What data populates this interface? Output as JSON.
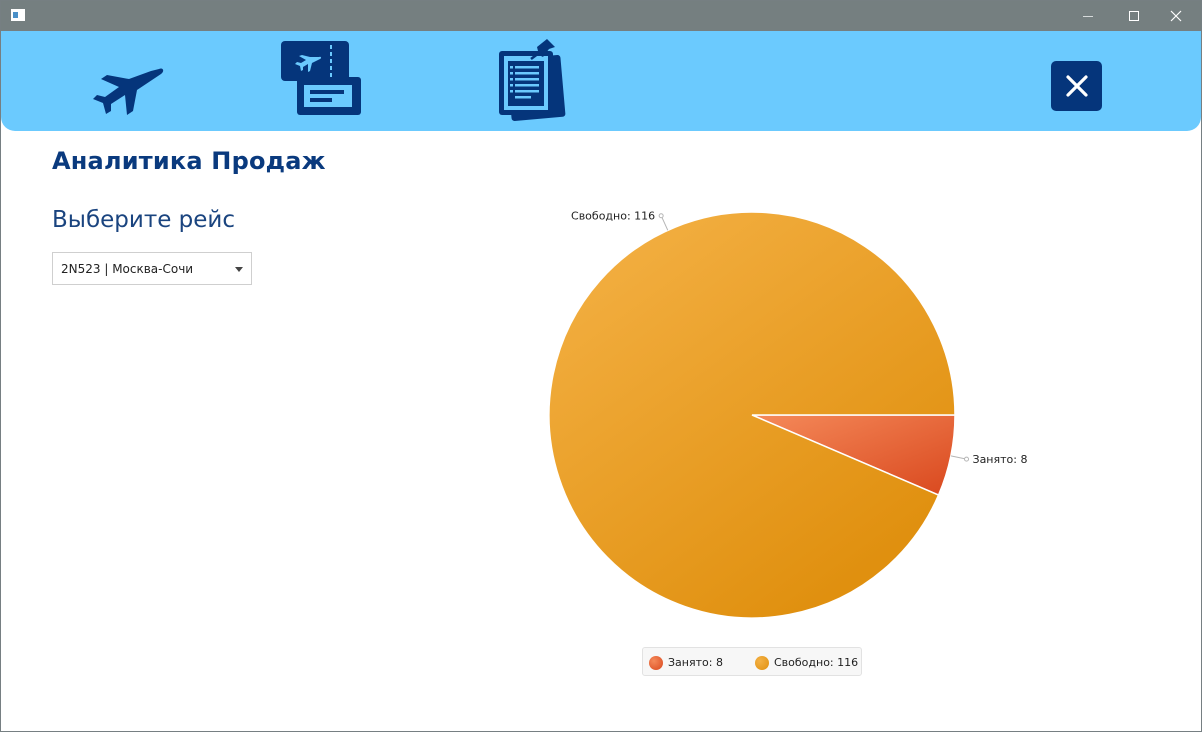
{
  "app": {
    "dropdown_arrow": "chevron-down"
  },
  "toolbar": {
    "icons": [
      "airplane-icon",
      "ticket-icon",
      "clipboard-report-icon",
      "close-icon"
    ],
    "accent": "#6bcafe",
    "icon_color": "#05357b"
  },
  "main": {
    "title": "Аналитика Продаж",
    "select_label": "Выберите рейс",
    "flight_select": {
      "value": "2N523 | Москва-Сочи"
    }
  },
  "chart_data": {
    "type": "pie",
    "title": "",
    "slices": [
      {
        "label": "Занято",
        "value": 8,
        "display": "Занято: 8",
        "color": "#e05a2c"
      },
      {
        "label": "Свободно",
        "value": 116,
        "display": "Свободно: 116",
        "color": "#eba22a"
      }
    ],
    "legend": {
      "placement": "bottom",
      "entries": [
        "Занято: 8",
        "Свободно: 116"
      ]
    }
  }
}
